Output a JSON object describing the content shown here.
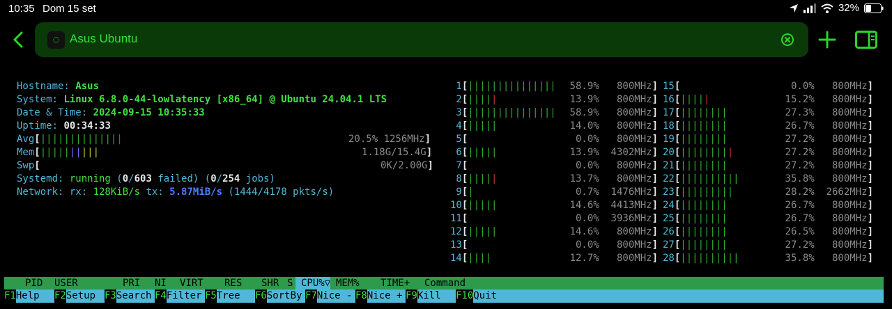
{
  "statusbar": {
    "time": "10:35",
    "date": "Dom 15 set",
    "battery": "32%"
  },
  "toolbar": {
    "title": "Asus Ubuntu"
  },
  "system": {
    "hostname_label": "Hostname: ",
    "hostname": "Asus",
    "system_label": "System: ",
    "system": "Linux 6.8.0-44-lowlatency [x86_64] @ Ubuntu 24.04.1 LTS",
    "datetime_label": "Date & Time: ",
    "datetime": "2024-09-15 10:35:33",
    "uptime_label": "Uptime: ",
    "uptime": "00:34:33",
    "avg_label": "Avg",
    "avg_value": "20.5% 1256MHz",
    "mem_label": "Mem",
    "mem_value": "1.18G/15.4G",
    "swp_label": "Swp",
    "swp_value": "0K/2.00G",
    "systemd_label": "Systemd: ",
    "systemd_state": "running",
    "systemd_failed": "0",
    "systemd_units": "603",
    "systemd_jobs_a": "0",
    "systemd_jobs_b": "254",
    "network_label": "Network: ",
    "rx_label": "rx: ",
    "rx": "128KiB/s",
    "tx_label": "tx: ",
    "tx": "5.87MiB/s",
    "pkts": "(1444/4178 pkts/s)"
  },
  "cpus": [
    {
      "n": "1",
      "pct": "58.9%",
      "mhz": "800MHz",
      "bars": "|||||||||||||||",
      "red": ""
    },
    {
      "n": "2",
      "pct": "13.9%",
      "mhz": "800MHz",
      "bars": "||||",
      "red": "|"
    },
    {
      "n": "3",
      "pct": "58.9%",
      "mhz": "800MHz",
      "bars": "|||||||||||||||",
      "red": ""
    },
    {
      "n": "4",
      "pct": "14.0%",
      "mhz": "800MHz",
      "bars": "|||||",
      "red": ""
    },
    {
      "n": "5",
      "pct": "0.0%",
      "mhz": "800MHz",
      "bars": "",
      "red": ""
    },
    {
      "n": "6",
      "pct": "13.9%",
      "mhz": "4302MHz",
      "bars": "|||||",
      "red": ""
    },
    {
      "n": "7",
      "pct": "0.0%",
      "mhz": "800MHz",
      "bars": "",
      "red": ""
    },
    {
      "n": "8",
      "pct": "13.7%",
      "mhz": "800MHz",
      "bars": "||||",
      "red": "|"
    },
    {
      "n": "9",
      "pct": "0.7%",
      "mhz": "1476MHz",
      "bars": "|",
      "red": ""
    },
    {
      "n": "10",
      "pct": "14.6%",
      "mhz": "4413MHz",
      "bars": "|||||",
      "red": ""
    },
    {
      "n": "11",
      "pct": "0.0%",
      "mhz": "3936MHz",
      "bars": "",
      "red": ""
    },
    {
      "n": "12",
      "pct": "14.6%",
      "mhz": "800MHz",
      "bars": "|||||",
      "red": ""
    },
    {
      "n": "13",
      "pct": "0.0%",
      "mhz": "800MHz",
      "bars": "",
      "red": ""
    },
    {
      "n": "14",
      "pct": "12.7%",
      "mhz": "800MHz",
      "bars": "||||",
      "red": ""
    },
    {
      "n": "15",
      "pct": "0.0%",
      "mhz": "800MHz",
      "bars": "",
      "red": ""
    },
    {
      "n": "16",
      "pct": "15.2%",
      "mhz": "800MHz",
      "bars": "||||",
      "red": "|"
    },
    {
      "n": "17",
      "pct": "27.3%",
      "mhz": "800MHz",
      "bars": "||||||||",
      "red": ""
    },
    {
      "n": "18",
      "pct": "26.7%",
      "mhz": "800MHz",
      "bars": "||||||||",
      "red": ""
    },
    {
      "n": "19",
      "pct": "27.2%",
      "mhz": "800MHz",
      "bars": "||||||||",
      "red": ""
    },
    {
      "n": "20",
      "pct": "27.2%",
      "mhz": "800MHz",
      "bars": "||||||||",
      "red": "|"
    },
    {
      "n": "21",
      "pct": "27.2%",
      "mhz": "800MHz",
      "bars": "||||||||",
      "red": ""
    },
    {
      "n": "22",
      "pct": "35.8%",
      "mhz": "800MHz",
      "bars": "||||||||||",
      "red": ""
    },
    {
      "n": "23",
      "pct": "28.2%",
      "mhz": "2662MHz",
      "bars": "|||||||||",
      "red": ""
    },
    {
      "n": "24",
      "pct": "26.7%",
      "mhz": "800MHz",
      "bars": "||||||||",
      "red": ""
    },
    {
      "n": "25",
      "pct": "26.7%",
      "mhz": "800MHz",
      "bars": "||||||||",
      "red": ""
    },
    {
      "n": "26",
      "pct": "26.5%",
      "mhz": "800MHz",
      "bars": "||||||||",
      "red": ""
    },
    {
      "n": "27",
      "pct": "27.2%",
      "mhz": "800MHz",
      "bars": "||||||||",
      "red": ""
    },
    {
      "n": "28",
      "pct": "35.8%",
      "mhz": "800MHz",
      "bars": "||||||||||",
      "red": ""
    }
  ],
  "columns": [
    "PID",
    "USER",
    "PRI",
    "NI",
    "VIRT",
    "RES",
    "SHR",
    "S",
    "CPU%▽",
    "MEM%",
    "TIME+",
    "Command"
  ],
  "fkeys": [
    {
      "key": "F1",
      "label": "Help"
    },
    {
      "key": "F2",
      "label": "Setup"
    },
    {
      "key": "F3",
      "label": "Search"
    },
    {
      "key": "F4",
      "label": "Filter"
    },
    {
      "key": "F5",
      "label": "Tree"
    },
    {
      "key": "F6",
      "label": "SortBy"
    },
    {
      "key": "F7",
      "label": "Nice -"
    },
    {
      "key": "F8",
      "label": "Nice +"
    },
    {
      "key": "F9",
      "label": "Kill"
    },
    {
      "key": "F10",
      "label": "Quit"
    }
  ]
}
